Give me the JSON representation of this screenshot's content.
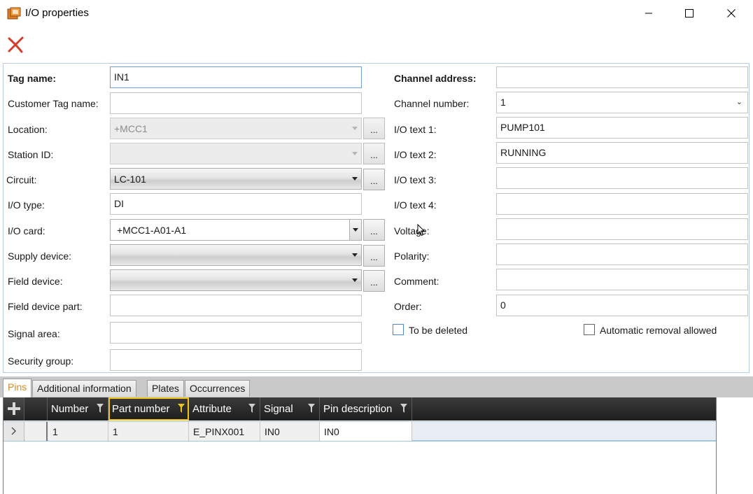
{
  "window": {
    "title": "I/O properties"
  },
  "form": {
    "left": {
      "tag_name": {
        "label": "Tag name:",
        "value": "IN1"
      },
      "customer_tag_name": {
        "label": "Customer Tag name:",
        "value": ""
      },
      "location": {
        "label": "Location:",
        "value": "+MCC1"
      },
      "station_id": {
        "label": "Station ID:",
        "value": ""
      },
      "circuit": {
        "label": "Circuit:",
        "value": "LC-101"
      },
      "io_type": {
        "label": "I/O type:",
        "value": "DI"
      },
      "io_card": {
        "label": "I/O card:",
        "value": "+MCC1-A01-A1"
      },
      "supply_device": {
        "label": "Supply device:",
        "value": ""
      },
      "field_device": {
        "label": "Field device:",
        "value": ""
      },
      "field_device_part": {
        "label": "Field device part:",
        "value": ""
      },
      "signal_area": {
        "label": "Signal area:",
        "value": ""
      },
      "security_group": {
        "label": "Security group:",
        "value": ""
      },
      "browse_label": "..."
    },
    "right": {
      "channel_address": {
        "label": "Channel address:",
        "value": ""
      },
      "channel_number": {
        "label": "Channel number:",
        "value": "1"
      },
      "io_text_1": {
        "label": "I/O text 1:",
        "value": "PUMP101"
      },
      "io_text_2": {
        "label": "I/O text 2:",
        "value": "RUNNING"
      },
      "io_text_3": {
        "label": "I/O text 3:",
        "value": ""
      },
      "io_text_4": {
        "label": "I/O text 4:",
        "value": ""
      },
      "voltage": {
        "label": "Voltage:",
        "value": ""
      },
      "polarity": {
        "label": "Polarity:",
        "value": ""
      },
      "comment": {
        "label": "Comment:",
        "value": ""
      },
      "order": {
        "label": "Order:",
        "value": "0"
      },
      "to_be_deleted": {
        "label": "To be deleted",
        "checked": false
      },
      "automatic_removal": {
        "label": "Automatic removal allowed",
        "checked": false
      }
    }
  },
  "tabs": [
    {
      "label": "Pins",
      "active": true
    },
    {
      "label": "Additional information",
      "active": false
    },
    {
      "label": "Plates",
      "active": false
    },
    {
      "label": "Occurrences",
      "active": false
    }
  ],
  "grid": {
    "columns": [
      "Number",
      "Part number",
      "Attribute",
      "Signal",
      "Pin description"
    ],
    "rows": [
      {
        "number": "1",
        "part_number": "1",
        "attribute": "E_PINX001",
        "signal": "IN0",
        "pin_description": "IN0"
      }
    ]
  },
  "colors": {
    "active_tab": "#d98a22",
    "header_bg": "#1e1e1e",
    "highlight_border": "#f0c419",
    "delete_icon": "#d63c2a"
  },
  "icons": {
    "app": "io-properties-app-icon",
    "delete": "delete-x-icon",
    "add": "plus-icon",
    "filter": "filter-funnel-icon",
    "row": "chevron-right-icon"
  }
}
